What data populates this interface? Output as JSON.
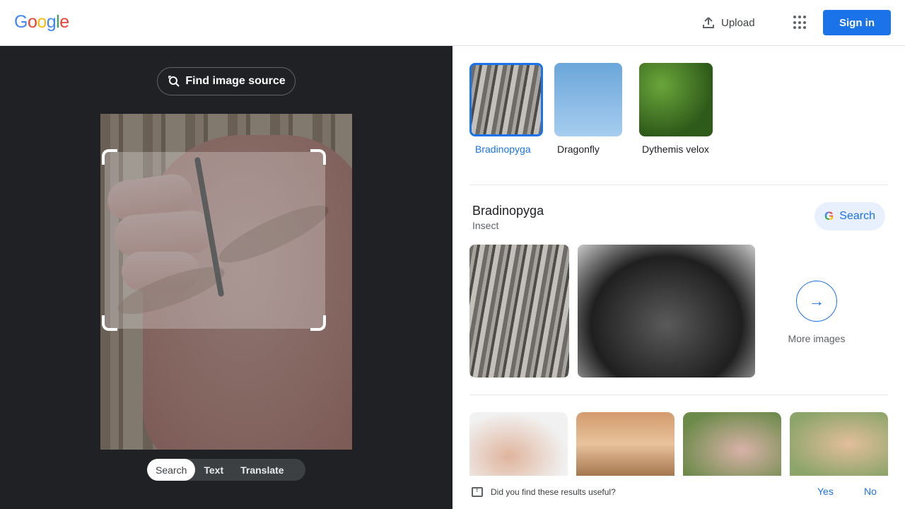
{
  "header": {
    "logo_letters": [
      {
        "char": "G",
        "color": "#4285f4"
      },
      {
        "char": "o",
        "color": "#ea4335"
      },
      {
        "char": "o",
        "color": "#fbbc05"
      },
      {
        "char": "g",
        "color": "#4285f4"
      },
      {
        "char": "l",
        "color": "#34a853"
      },
      {
        "char": "e",
        "color": "#ea4335"
      }
    ],
    "upload_label": "Upload",
    "signin_label": "Sign in"
  },
  "left_panel": {
    "find_source_label": "Find image source",
    "modes": [
      "Search",
      "Text",
      "Translate"
    ],
    "active_mode": "Search"
  },
  "results": {
    "chips": [
      {
        "label": "Bradinopyga",
        "active": true,
        "image": "bark"
      },
      {
        "label": "Dragonfly",
        "active": false,
        "image": "sky"
      },
      {
        "label": "Dythemis velox",
        "active": false,
        "image": "green"
      }
    ],
    "entity": {
      "title": "Bradinopyga",
      "subtitle": "Insect",
      "search_label": "Search",
      "more_label": "More images"
    },
    "feedback": {
      "question": "Did you find these results useful?",
      "yes": "Yes",
      "no": "No"
    }
  },
  "colors": {
    "accent": "#1a73e8",
    "dark_panel": "#202124"
  }
}
